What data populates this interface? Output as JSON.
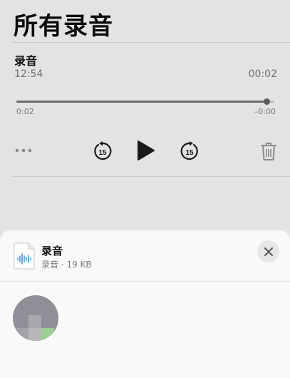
{
  "header": {
    "title": "所有录音"
  },
  "recording": {
    "name": "录音",
    "date": "12:54",
    "duration": "00:02",
    "elapsed": "0:02",
    "remaining": "–0:00",
    "progress_fraction": 0.97,
    "skip_back_seconds": "15",
    "skip_forward_seconds": "15"
  },
  "share_sheet": {
    "file_name": "录音",
    "file_meta": "录音 · 19 KB"
  },
  "colors": {
    "background": "#e3e3e3",
    "sheet": "#f9f9f9",
    "file_icon_accent": "#4a90d9"
  },
  "icons": {
    "more": "ellipsis-icon",
    "skip_back": "skip-back-15-icon",
    "play": "play-icon",
    "skip_forward": "skip-forward-15-icon",
    "trash": "trash-icon",
    "close": "close-icon",
    "file": "audio-file-icon"
  }
}
